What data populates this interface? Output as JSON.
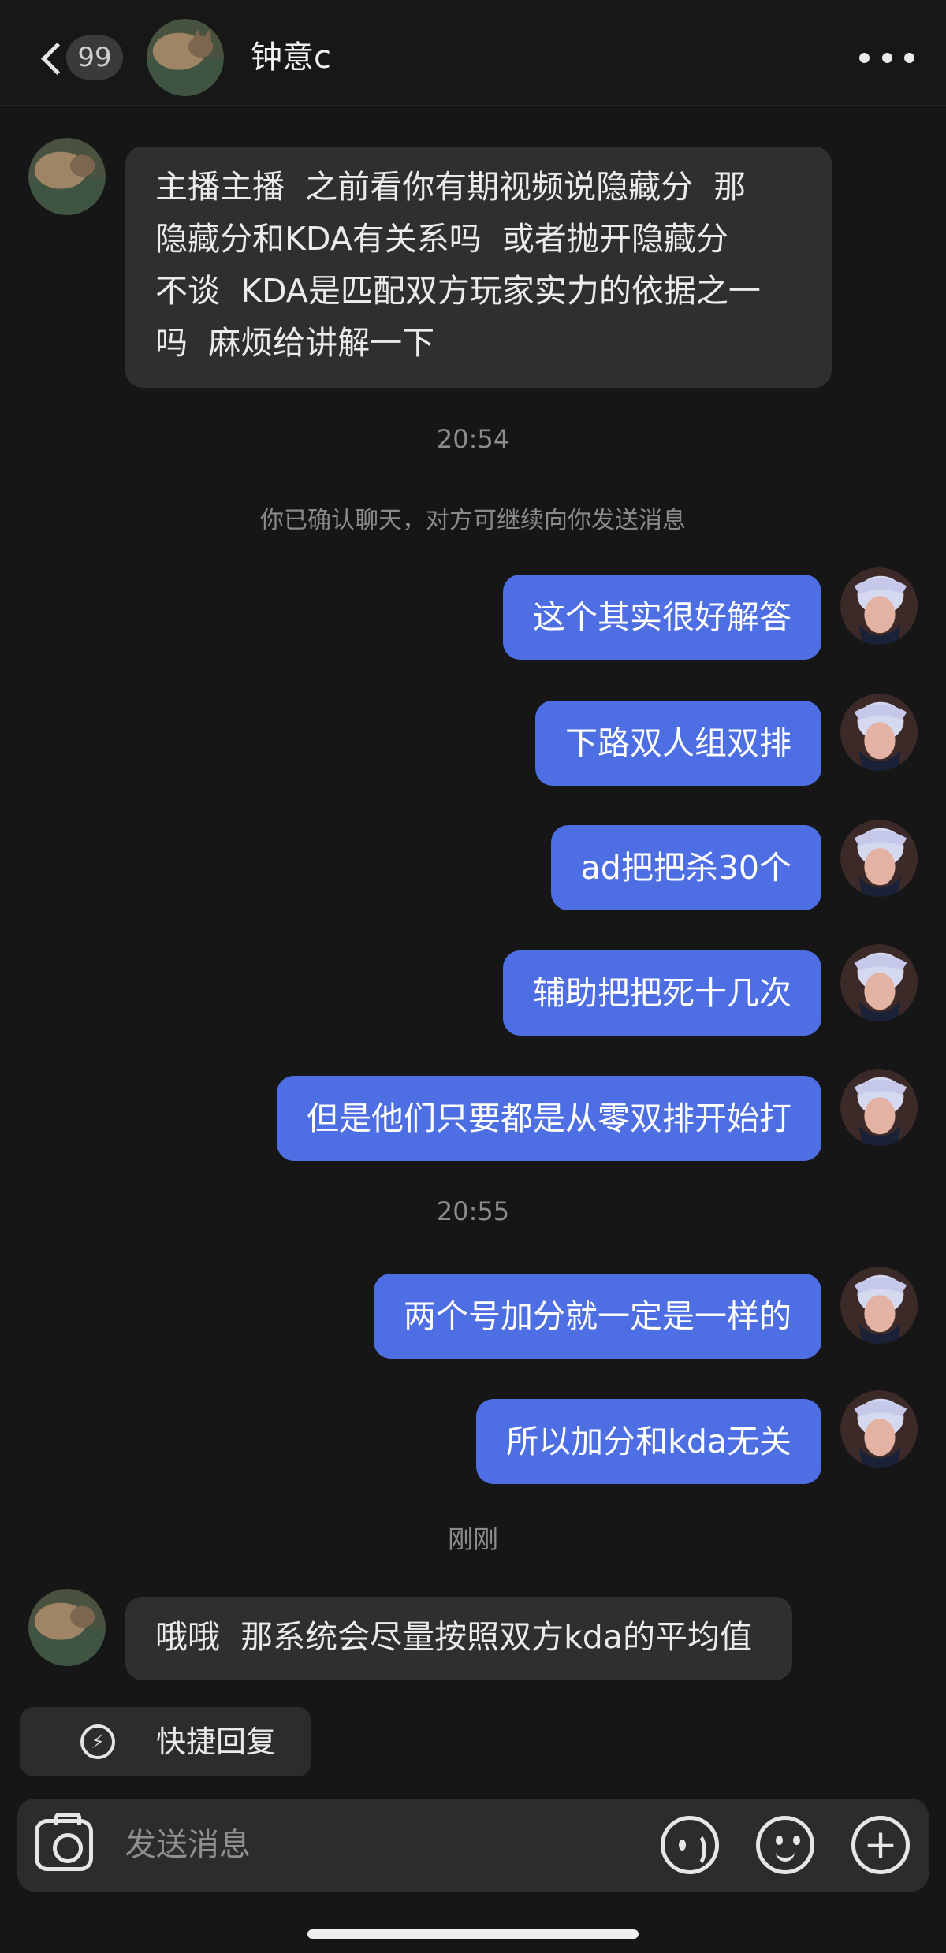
{
  "header": {
    "back_badge": "99",
    "contact_name": "钟意c",
    "avatar_icon": "cat-photo-avatar-icon",
    "more_icon": "more-dots-icon"
  },
  "messages": [
    {
      "side": "left",
      "text": "主播主播  之前看你有期视频说隐藏分  那\n隐藏分和KDA有关系吗  或者抛开隐藏分\n不谈  KDA是匹配双方玩家实力的依据之一\n吗  麻烦给讲解一下"
    },
    {
      "kind": "time",
      "text": "20:54"
    },
    {
      "kind": "system",
      "text": "你已确认聊天，对方可继续向你发送消息"
    },
    {
      "side": "right",
      "text": "这个其实很好解答"
    },
    {
      "side": "right",
      "text": "下路双人组双排"
    },
    {
      "side": "right",
      "text": "ad把把杀30个"
    },
    {
      "side": "right",
      "text": "辅助把把死十几次"
    },
    {
      "side": "right",
      "text": "但是他们只要都是从零双排开始打"
    },
    {
      "kind": "time",
      "text": "20:55"
    },
    {
      "side": "right",
      "text": "两个号加分就一定是一样的"
    },
    {
      "side": "right",
      "text": "所以加分和kda无关"
    },
    {
      "kind": "time",
      "text": "刚刚"
    },
    {
      "side": "left",
      "text": "哦哦  那系统会尽量按照双方kda的平均值"
    }
  ],
  "quick_reply": {
    "label": "快捷回复",
    "icon": "lightning-icon"
  },
  "composer": {
    "placeholder": "发送消息",
    "camera_icon": "camera-icon",
    "voice_icon": "voice-icon",
    "emoji_icon": "emoji-icon",
    "plus_icon": "plus-icon"
  }
}
